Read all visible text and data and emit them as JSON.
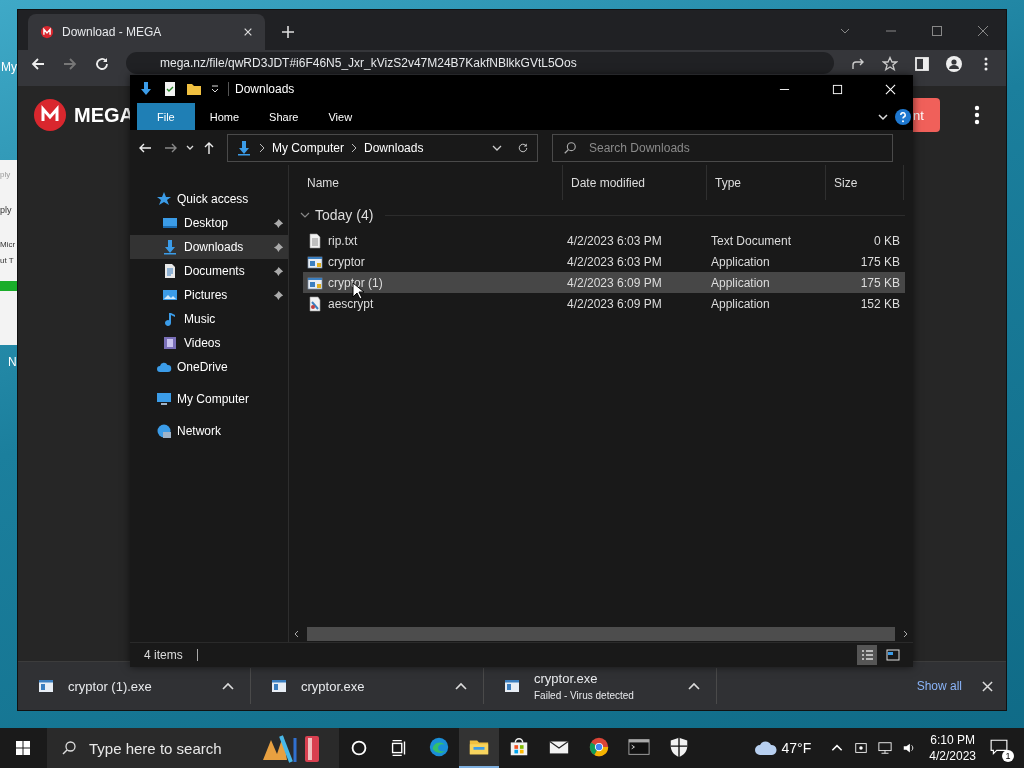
{
  "desktop": {
    "labels": [
      "My",
      "N"
    ]
  },
  "background_window": {
    "lines": [
      "ply",
      "ply",
      "Micr",
      "ut T"
    ]
  },
  "browser": {
    "tab_title": "Download - MEGA",
    "address": "mega.nz/file/qwRD3JDT#i6F46N5_Jxr_kVizS2v47M24B7KakfNBlkkGVtL5Oos",
    "logo": "MEGA",
    "button_text": "nt"
  },
  "explorer": {
    "title": "Downloads",
    "ribbon_tabs": [
      {
        "label": "File",
        "selected": true
      },
      {
        "label": "Home",
        "selected": false
      },
      {
        "label": "Share",
        "selected": false
      },
      {
        "label": "View",
        "selected": false
      }
    ],
    "path": [
      "My Computer",
      "Downloads"
    ],
    "search_placeholder": "Search Downloads",
    "nav": [
      {
        "label": "Quick access",
        "kind": "star",
        "selected": false,
        "children": [
          {
            "label": "Desktop",
            "kind": "desktop",
            "selected": false,
            "pinned": true
          },
          {
            "label": "Downloads",
            "kind": "download",
            "selected": true,
            "pinned": true
          },
          {
            "label": "Documents",
            "kind": "document",
            "selected": false,
            "pinned": true
          },
          {
            "label": "Pictures",
            "kind": "picture",
            "selected": false,
            "pinned": true
          },
          {
            "label": "Music",
            "kind": "music",
            "selected": false,
            "pinned": false
          },
          {
            "label": "Videos",
            "kind": "video",
            "selected": false,
            "pinned": false
          }
        ]
      },
      {
        "label": "OneDrive",
        "kind": "cloud",
        "selected": false
      },
      {
        "label": "My Computer",
        "kind": "computer",
        "selected": false
      },
      {
        "label": "Network",
        "kind": "network",
        "selected": false
      }
    ],
    "columns": [
      "Name",
      "Date modified",
      "Type",
      "Size"
    ],
    "group": "Today (4)",
    "files": [
      {
        "name": "rip.txt",
        "kind": "text",
        "date": "4/2/2023 6:03 PM",
        "type": "Text Document",
        "size": "0 KB",
        "selected": false
      },
      {
        "name": "cryptor",
        "kind": "app",
        "date": "4/2/2023 6:03 PM",
        "type": "Application",
        "size": "175 KB",
        "selected": false
      },
      {
        "name": "cryptor (1)",
        "kind": "app",
        "date": "4/2/2023 6:09 PM",
        "type": "Application",
        "size": "175 KB",
        "selected": true
      },
      {
        "name": "aescrypt",
        "kind": "setup",
        "date": "4/2/2023 6:09 PM",
        "type": "Application",
        "size": "152 KB",
        "selected": false
      }
    ],
    "status": "4 items"
  },
  "downloads_bar": {
    "items": [
      {
        "name": "cryptor (1).exe"
      },
      {
        "name": "cryptor.exe"
      },
      {
        "name": "cryptor.exe",
        "status": "Failed - Virus detected"
      }
    ],
    "show_all": "Show all"
  },
  "taskbar": {
    "search_placeholder": "Type here to search",
    "apps": [
      {
        "kind": "edge",
        "selected": false
      },
      {
        "kind": "folder",
        "selected": true
      },
      {
        "kind": "store",
        "selected": false
      },
      {
        "kind": "mail",
        "selected": false
      },
      {
        "kind": "chrome",
        "selected": false
      },
      {
        "kind": "terminal",
        "selected": false
      },
      {
        "kind": "shield",
        "selected": false
      }
    ],
    "weather": "47°F",
    "time": "6:10 PM",
    "date": "4/2/2023",
    "notifications": "1"
  }
}
